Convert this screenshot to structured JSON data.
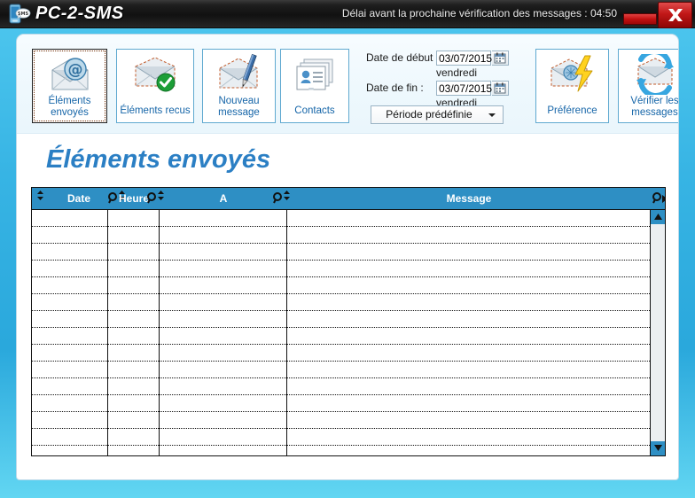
{
  "window": {
    "app_title": "PC-2-SMS",
    "logo_icon": "sms-phone-icon",
    "countdown_text": "Délai avant la prochaine vérification des messages : 04:50",
    "minimize_label": "minimize",
    "close_label": "close"
  },
  "toolbar": {
    "buttons": [
      {
        "id": "sent",
        "label_line1": "Éléments",
        "label_line2": "envoyés",
        "icon": "envelope-at-icon",
        "selected": true
      },
      {
        "id": "received",
        "label_line1": "Éléments recus",
        "label_line2": "",
        "icon": "envelope-check-icon",
        "selected": false
      },
      {
        "id": "new",
        "label_line1": "Nouveau",
        "label_line2": "message",
        "icon": "envelope-pen-icon",
        "selected": false
      },
      {
        "id": "contacts",
        "label_line1": "Contacts",
        "label_line2": "",
        "icon": "contacts-card-icon",
        "selected": false
      },
      {
        "id": "pref",
        "label_line1": "Préférence",
        "label_line2": "",
        "icon": "envelope-lightning-icon",
        "selected": false
      },
      {
        "id": "check",
        "label_line1": "Vérifier les",
        "label_line2": "messages",
        "icon": "envelope-refresh-icon",
        "selected": false
      }
    ]
  },
  "dates": {
    "start_label": "Date de début :",
    "start_value": "03/07/2015",
    "start_dayname": "vendredi",
    "end_label": "Date de fin :",
    "end_value": "03/07/2015",
    "end_dayname": "vendredi",
    "calendar_icon": "calendar-icon",
    "period_selected": "Période prédéfinie",
    "period_arrow_icon": "chevron-down-icon"
  },
  "page": {
    "heading": "Éléments envoyés"
  },
  "grid": {
    "columns": [
      {
        "key": "date",
        "label": "Date"
      },
      {
        "key": "heure",
        "label": "Heure"
      },
      {
        "key": "a",
        "label": "A"
      },
      {
        "key": "message",
        "label": "Message"
      }
    ],
    "rows": [],
    "empty_row_count": 15,
    "sort_icon": "sort-updown-icon",
    "filter_icon": "magnifier-icon",
    "scroll_up_icon": "triangle-up-icon",
    "scroll_down_icon": "triangle-down-icon"
  },
  "colors": {
    "frame_blue": "#37b4e4",
    "header_blue": "#2e8fc4",
    "heading_blue": "#2b7fc4",
    "label_blue": "#1565a8",
    "close_red": "#c11717"
  }
}
